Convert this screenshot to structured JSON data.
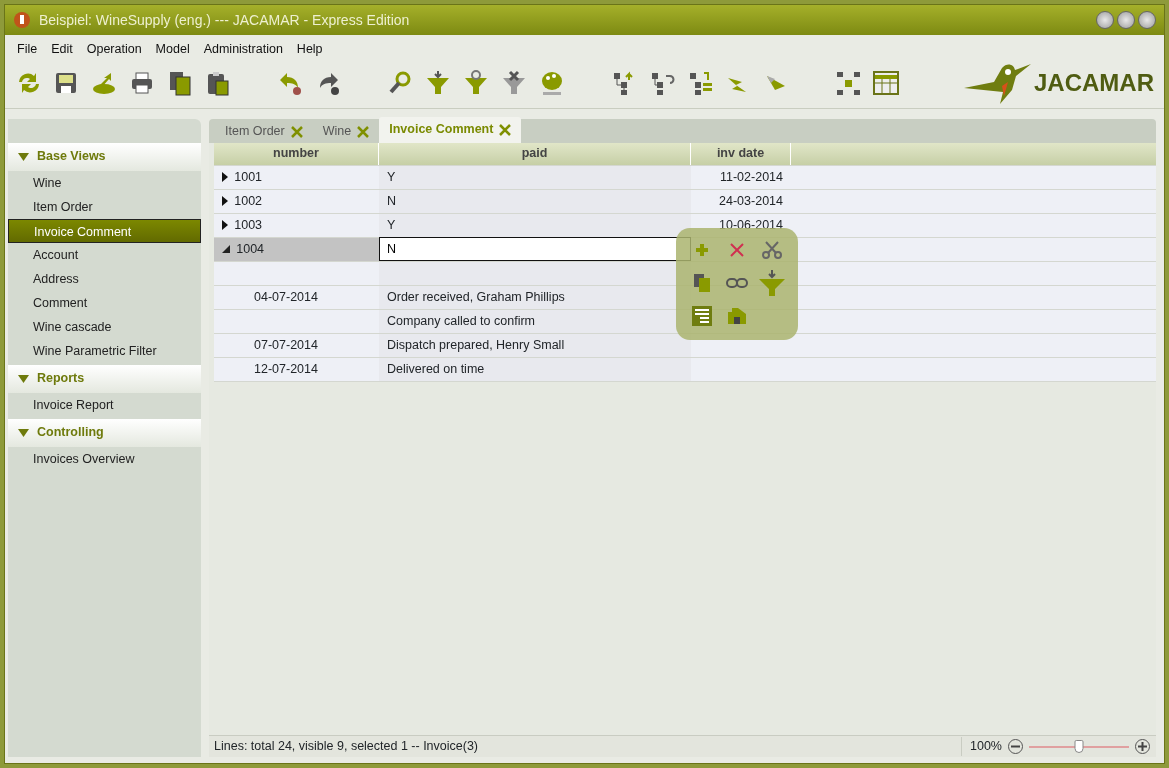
{
  "window": {
    "title": "Beispiel: WineSupply (eng.) --- JACAMAR - Express Edition"
  },
  "menu": [
    "File",
    "Edit",
    "Operation",
    "Model",
    "Administration",
    "Help"
  ],
  "logo": {
    "text": "JACAMAR"
  },
  "sidebar": {
    "sections": [
      {
        "title": "Base Views",
        "expanded": true,
        "items": [
          {
            "label": "Wine",
            "selected": false
          },
          {
            "label": "Item Order",
            "selected": false
          },
          {
            "label": "Invoice Comment",
            "selected": true
          },
          {
            "label": "Account",
            "selected": false
          },
          {
            "label": "Address",
            "selected": false
          },
          {
            "label": "Comment",
            "selected": false
          },
          {
            "label": "Wine cascade",
            "selected": false
          },
          {
            "label": "Wine Parametric Filter",
            "selected": false
          }
        ]
      },
      {
        "title": "Reports",
        "expanded": true,
        "items": [
          {
            "label": "Invoice Report",
            "selected": false
          }
        ]
      },
      {
        "title": "Controlling",
        "expanded": true,
        "items": [
          {
            "label": "Invoices Overview",
            "selected": false
          }
        ]
      }
    ]
  },
  "tabs": [
    {
      "label": "Item Order",
      "selected": false
    },
    {
      "label": "Wine",
      "selected": false
    },
    {
      "label": "Invoice Comment",
      "selected": true
    }
  ],
  "table": {
    "columns": [
      "number",
      "paid",
      "inv date"
    ],
    "rows": [
      {
        "number": "1001",
        "paid": "Y",
        "inv_date": "11-02-2014",
        "expanded": false,
        "selected": false,
        "editing": false
      },
      {
        "number": "1002",
        "paid": "N",
        "inv_date": "24-03-2014",
        "expanded": false,
        "selected": false,
        "editing": false
      },
      {
        "number": "1003",
        "paid": "Y",
        "inv_date": "10-06-2014",
        "expanded": false,
        "selected": false,
        "editing": false
      },
      {
        "number": "1004",
        "paid": "N",
        "expanded": true,
        "selected": true,
        "editing": true,
        "children": [
          {
            "date": "04-07-2014",
            "comment": "Order received, Graham Phillips"
          },
          {
            "comment": "Company called to confirm"
          },
          {
            "date": "07-07-2014",
            "comment": "Dispatch prepared, Henry Small"
          },
          {
            "date": "12-07-2014",
            "comment": "Delivered on time"
          }
        ]
      }
    ]
  },
  "status_bar": {
    "text": "Lines: total 24, visible 9, selected 1  -- Invoice(3)",
    "zoom": "100%",
    "level": 0.5
  }
}
